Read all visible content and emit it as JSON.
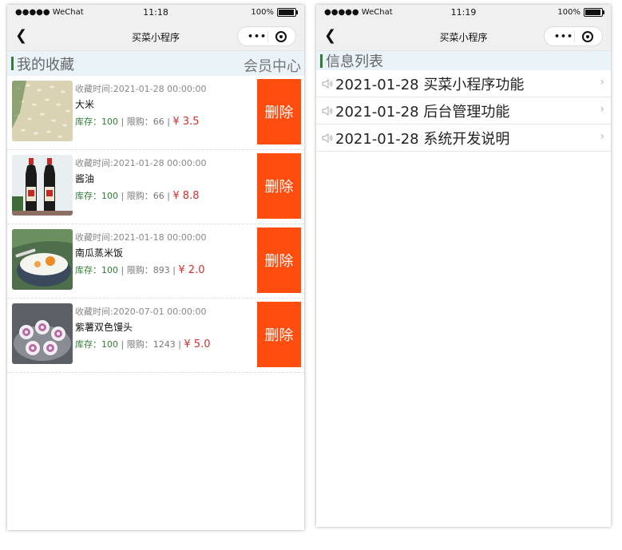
{
  "status_bar": {
    "signal": "●●●●● WeChat",
    "battery": "100%"
  },
  "left_screen": {
    "time": "11:18",
    "nav_title": "买菜小程序",
    "section_title": "我的收藏",
    "member_link": "会员中心",
    "items": [
      {
        "time": "收藏时间:2021-01-28 00:00:00",
        "name": "大米",
        "stock_label": "库存：100",
        "limit_label": "限购：66",
        "price": "¥ 3.5",
        "delete_label": "删除",
        "image": "rice-grains"
      },
      {
        "time": "收藏时间:2021-01-28 00:00:00",
        "name": "酱油",
        "stock_label": "库存：100",
        "limit_label": "限购：66",
        "price": "¥ 8.8",
        "delete_label": "删除",
        "image": "soy-sauce-bottles"
      },
      {
        "time": "收藏时间:2021-01-18 00:00:00",
        "name": "南瓜蒸米饭",
        "stock_label": "库存：100",
        "limit_label": "限购：893",
        "price": "¥ 2.0",
        "delete_label": "删除",
        "image": "pumpkin-rice-bowl"
      },
      {
        "time": "收藏时间:2020-07-01 00:00:00",
        "name": "紫薯双色馒头",
        "stock_label": "库存：100",
        "limit_label": "限购：1243",
        "price": "¥ 5.0",
        "delete_label": "删除",
        "image": "purple-potato-buns"
      }
    ]
  },
  "right_screen": {
    "time": "11:19",
    "nav_title": "买菜小程序",
    "section_title": "信息列表",
    "items": [
      {
        "text": "2021-01-28 买菜小程序功能"
      },
      {
        "text": "2021-01-28 后台管理功能"
      },
      {
        "text": "2021-01-28 系统开发说明"
      }
    ]
  },
  "colors": {
    "accent_green": "#2e7d32",
    "delete_orange": "#ff4d0f",
    "price_red": "#d32f2f",
    "header_bg": "#e9f3f8"
  },
  "icons": [
    "back-arrow-icon",
    "more-dots-icon",
    "close-target-icon",
    "speaker-icon",
    "chevron-right-icon",
    "battery-icon",
    "wifi-icon"
  ]
}
